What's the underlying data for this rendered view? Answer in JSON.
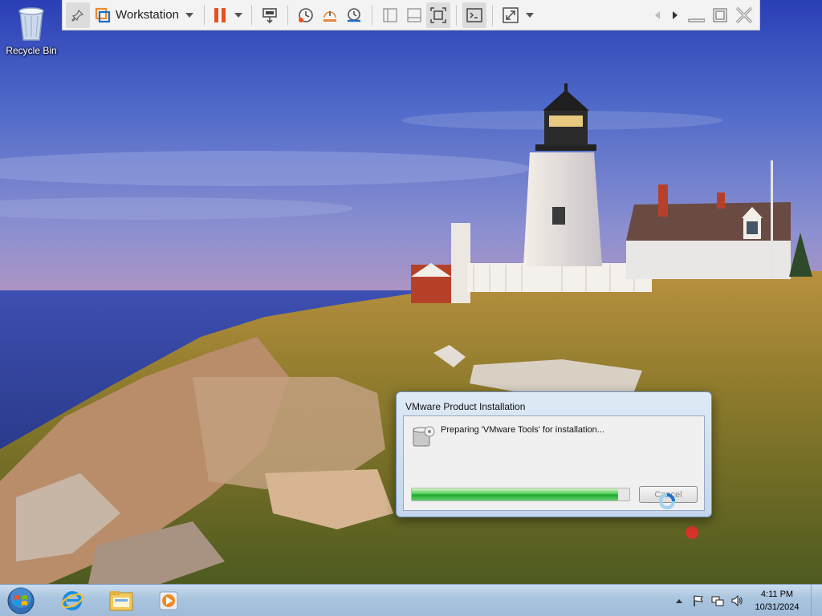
{
  "desktop": {
    "icons": [
      {
        "label": "Recycle Bin",
        "icon": "recycle-bin-icon"
      }
    ]
  },
  "vmware_toolbar": {
    "menu_label": "Workstation",
    "buttons": [
      "pin-icon",
      "workstation-logo-icon",
      "pause-icon",
      "send-ctrl-alt-del-icon",
      "snapshot-icon",
      "revert-snapshot-icon",
      "snapshot-manager-icon",
      "thumbnail-bar-icon",
      "library-icon",
      "fullscreen-icon",
      "console-icon",
      "stretch-icon",
      "prev-icon",
      "next-icon",
      "minimize-icon",
      "restore-icon",
      "close-icon"
    ],
    "colors": {
      "pause": "#e8501f",
      "accent": "#1b6ec2"
    }
  },
  "dialog": {
    "title": "VMware Product Installation",
    "message": "Preparing 'VMware Tools' for installation...",
    "progress_percent": 95,
    "cancel_label": "Cancel"
  },
  "taskbar": {
    "apps": [
      "internet-explorer-icon",
      "file-explorer-icon",
      "media-player-icon"
    ],
    "time": "4:11 PM",
    "date": "10/31/2024",
    "tray": [
      "show-hidden-icons-icon",
      "action-center-flag-icon",
      "network-icon",
      "volume-icon"
    ]
  }
}
